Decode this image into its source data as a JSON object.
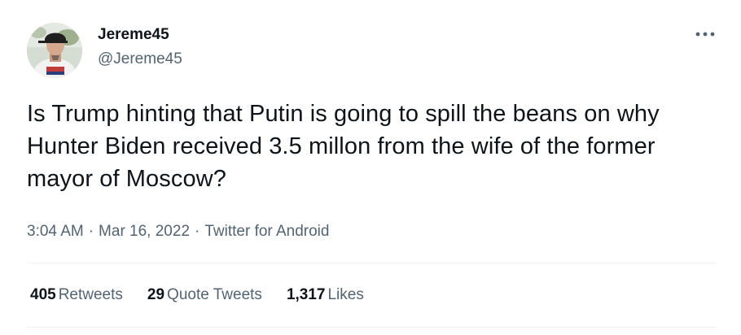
{
  "author": {
    "display_name": "Jereme45",
    "handle": "@Jereme45"
  },
  "more_icon": "more-horizontal-icon",
  "tweet": {
    "text": "Is Trump hinting that Putin is going to spill the beans on why Hunter Biden received 3.5 millon from the wife of the former mayor of Moscow?"
  },
  "meta": {
    "time": "3:04 AM",
    "separator": "·",
    "date": "Mar 16, 2022",
    "source": "Twitter for Android"
  },
  "stats": [
    {
      "count": "405",
      "label": "Retweets"
    },
    {
      "count": "29",
      "label": "Quote Tweets"
    },
    {
      "count": "1,317",
      "label": "Likes"
    }
  ],
  "colors": {
    "text_primary": "#0f1419",
    "text_secondary": "#536471",
    "divider": "#eff3f4"
  }
}
